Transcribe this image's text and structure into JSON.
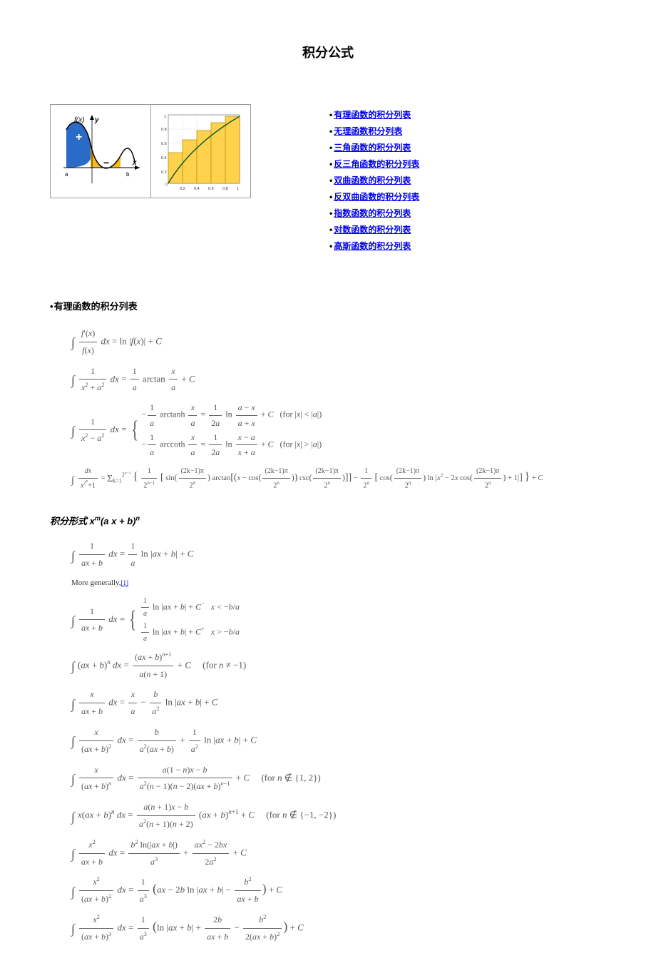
{
  "title": "积分公式",
  "toc": [
    "有理函数的积分列表",
    "无理函数积分列表",
    "三角函数的积分列表",
    "反三角函数的积分列表",
    "双曲函数的积分列表",
    "反双曲函数的积分列表",
    "指数函数的积分列表",
    "对数函数的积分列表",
    "高斯函数的积分列表"
  ],
  "section1_title": "有理函数的积分列表",
  "section2_title": "积分形式 xᵐ(a x + b)ⁿ",
  "more_generally": "More generally,",
  "ref": "[1]",
  "formulas1": {
    "f1": "∫ f'(x)/f(x) dx = ln|f(x)| + C",
    "f2": "∫ 1/(x²+a²) dx = (1/a) arctan(x/a) + C",
    "f3_left": "∫ 1/(x²−a²) dx =",
    "f3_c1": "−(1/a) arctanh(x/a) = (1/2a) ln((a−x)/(a+x)) + C   (for |x| < |a|)",
    "f3_c2": "−(1/a) arccoth(x/a) = (1/2a) ln((x−a)/(x+a)) + C   (for |x| > |a|)",
    "f4": "∫ dx/(x²ⁿ+1) = Σₖ₌₁^{2ⁿ⁻¹} { 1/2ⁿ⁻¹ [ sin((2k−1)π/2ⁿ) arctan[(x − cos((2k−1)π/2ⁿ)) csc((2k−1)π/2ⁿ)] ] − 1/2ⁿ [ cos((2k−1)π/2ⁿ) ln|x² − 2x cos((2k−1)π/2ⁿ) + 1| ] } + C"
  },
  "formulas2": {
    "g1": "∫ 1/(ax+b) dx = (1/a) ln|ax+b| + C",
    "g2_left": "∫ 1/(ax+b) dx =",
    "g2_c1": "(1/a) ln|ax+b| + C⁻   x < −b/a",
    "g2_c2": "(1/a) ln|ax+b| + C⁺   x > −b/a",
    "g3": "∫ (ax+b)ⁿ dx = (ax+b)ⁿ⁺¹ / (a(n+1)) + C      (for n ≠ −1)",
    "g4": "∫ x/(ax+b) dx = x/a − (b/a²) ln|ax+b| + C",
    "g5": "∫ x/(ax+b)² dx = b/(a²(ax+b)) + (1/a²) ln|ax+b| + C",
    "g6": "∫ x/(ax+b)ⁿ dx = (a(1−n)x − b) / (a²(n−1)(n−2)(ax+b)ⁿ⁻¹) + C      (for n ∉ {1,2})",
    "g7": "∫ x(ax+b)ⁿ dx = (a(n+1)x − b) / (a²(n+1)(n+2)) · (ax+b)ⁿ⁺¹ + C      (for n ∉ {−1,−2})",
    "g8": "∫ x²/(ax+b) dx = b² ln(|ax+b|)/a³ + (ax² − 2bx)/(2a²) + C",
    "g9": "∫ x²/(ax+b)² dx = (1/a³)(ax − 2b ln|ax+b| − b²/(ax+b)) + C",
    "g10": "∫ x²/(ax+b)³ dx = (1/a³)(ln|ax+b| + 2b/(ax+b) − b²/(2(ax+b)²)) + C"
  }
}
